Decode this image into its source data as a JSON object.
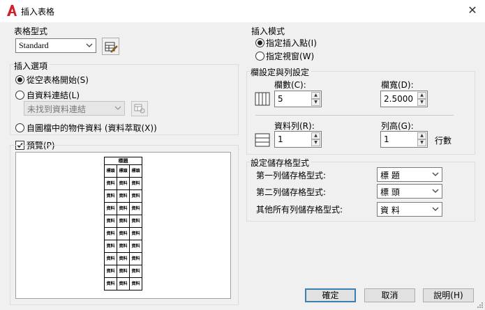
{
  "window": {
    "title": "插入表格",
    "close_glyph": "✕"
  },
  "table_style": {
    "group_label": "表格型式",
    "selected": "Standard"
  },
  "insert_options": {
    "group_label": "插入選項",
    "opt_empty": "從空表格開始(S)",
    "opt_data_link": "自資料連結(L)",
    "data_link_combo": "未找到資料連結",
    "opt_object_data": "自圖檔中的物件資料 (資料萃取(X))"
  },
  "preview": {
    "label": "預覽(P)",
    "checked": true,
    "table": {
      "title": "標題",
      "header": [
        "標頭",
        "標頭",
        "標頭"
      ],
      "cell": "資料",
      "data_rows": 9
    }
  },
  "insert_mode": {
    "group_label": "插入模式",
    "opt_point": "指定插入點(I)",
    "opt_window": "指定視窗(W)"
  },
  "col_row": {
    "group_label": "欄設定與列設定",
    "columns_label": "欄數(C):",
    "columns_value": "5",
    "col_width_label": "欄寬(D):",
    "col_width_value": "2.5000",
    "data_rows_label": "資料列(R):",
    "data_rows_value": "1",
    "row_height_label": "列高(G):",
    "row_height_value": "1",
    "row_height_unit": "行數"
  },
  "cell_styles": {
    "group_label": "設定儲存格型式",
    "first_row_label": "第一列儲存格型式:",
    "first_row_value": "標 題",
    "second_row_label": "第二列儲存格型式:",
    "second_row_value": "標 頭",
    "others_label": "其他所有列儲存格型式:",
    "others_value": "資 料"
  },
  "buttons": {
    "ok": "確定",
    "cancel": "取消",
    "help": "說明(H)"
  }
}
